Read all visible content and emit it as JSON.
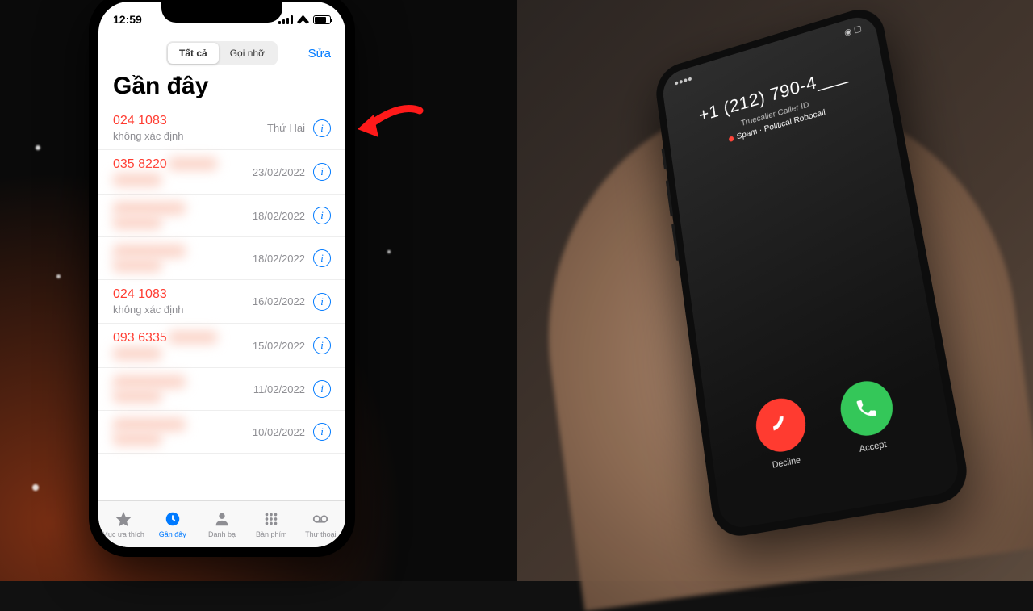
{
  "left_phone": {
    "status_time": "12:59",
    "segmented": {
      "all": "Tất cả",
      "missed": "Gọi nhỡ"
    },
    "edit": "Sửa",
    "title": "Gần đây",
    "calls": [
      {
        "number": "024 1083",
        "sub": "không xác định",
        "date": "Thứ Hai",
        "missed": true,
        "blurred": false
      },
      {
        "number": "035 8220",
        "sub": "",
        "date": "23/02/2022",
        "missed": true,
        "blurred": false,
        "num_blur_tail": true,
        "sub_blurred": true
      },
      {
        "number": "",
        "sub": "",
        "date": "18/02/2022",
        "missed": false,
        "blurred": true
      },
      {
        "number": "",
        "sub": "",
        "date": "18/02/2022",
        "missed": false,
        "blurred": true
      },
      {
        "number": "024 1083",
        "sub": "không xác định",
        "date": "16/02/2022",
        "missed": true,
        "blurred": false
      },
      {
        "number": "093 6335",
        "sub": "",
        "date": "15/02/2022",
        "missed": true,
        "blurred": false,
        "num_blur_tail": true,
        "sub_blurred": true
      },
      {
        "number": "",
        "sub": "",
        "date": "11/02/2022",
        "missed": false,
        "blurred": true
      },
      {
        "number": "",
        "sub": "",
        "date": "10/02/2022",
        "missed": false,
        "blurred": true
      }
    ],
    "tabs": {
      "favorites": "Mục ưa thích",
      "recents": "Gần đây",
      "contacts": "Danh bạ",
      "keypad": "Bàn phím",
      "voicemail": "Thư thoại"
    }
  },
  "right_phone": {
    "caller_number": "+1 (212) 790-4___",
    "caller_source": "Truecaller Caller ID",
    "caller_tag": "Spam · Political Robocall",
    "decline": "Decline",
    "accept": "Accept"
  }
}
